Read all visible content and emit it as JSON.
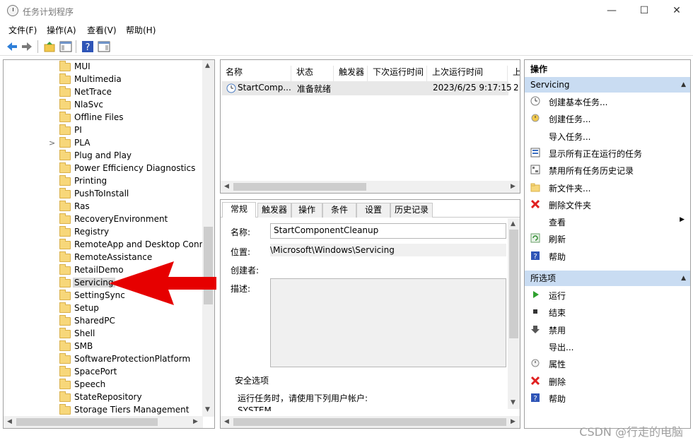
{
  "window": {
    "title": "任务计划程序",
    "minimize": "—",
    "maximize": "☐",
    "close": "✕"
  },
  "menu": [
    "文件(F)",
    "操作(A)",
    "查看(V)",
    "帮助(H)"
  ],
  "tree": {
    "items": [
      {
        "label": "MUI",
        "expander": ""
      },
      {
        "label": "Multimedia",
        "expander": ""
      },
      {
        "label": "NetTrace",
        "expander": ""
      },
      {
        "label": "NlaSvc",
        "expander": ""
      },
      {
        "label": "Offline Files",
        "expander": ""
      },
      {
        "label": "PI",
        "expander": ""
      },
      {
        "label": "PLA",
        "expander": ">"
      },
      {
        "label": "Plug and Play",
        "expander": ""
      },
      {
        "label": "Power Efficiency Diagnostics",
        "expander": ""
      },
      {
        "label": "Printing",
        "expander": ""
      },
      {
        "label": "PushToInstall",
        "expander": ""
      },
      {
        "label": "Ras",
        "expander": ""
      },
      {
        "label": "RecoveryEnvironment",
        "expander": ""
      },
      {
        "label": "Registry",
        "expander": ""
      },
      {
        "label": "RemoteApp and Desktop Conn",
        "expander": ""
      },
      {
        "label": "RemoteAssistance",
        "expander": ""
      },
      {
        "label": "RetailDemo",
        "expander": ""
      },
      {
        "label": "Servicing",
        "expander": "",
        "selected": true
      },
      {
        "label": "SettingSync",
        "expander": ""
      },
      {
        "label": "Setup",
        "expander": ""
      },
      {
        "label": "SharedPC",
        "expander": ""
      },
      {
        "label": "Shell",
        "expander": ""
      },
      {
        "label": "SMB",
        "expander": ""
      },
      {
        "label": "SoftwareProtectionPlatform",
        "expander": ""
      },
      {
        "label": "SpacePort",
        "expander": ""
      },
      {
        "label": "Speech",
        "expander": ""
      },
      {
        "label": "StateRepository",
        "expander": ""
      },
      {
        "label": "Storage Tiers Management",
        "expander": ""
      }
    ]
  },
  "tasks": {
    "columns": [
      "名称",
      "状态",
      "触发器",
      "下次运行时间",
      "上次运行时间",
      "上"
    ],
    "rows": [
      {
        "name": "StartComp...",
        "status": "准备就绪",
        "trigger": "",
        "next": "",
        "last": "2023/6/25 9:17:15",
        "extra": "2"
      }
    ]
  },
  "details": {
    "tabs": [
      "常规",
      "触发器",
      "操作",
      "条件",
      "设置",
      "历史记录"
    ],
    "name_label": "名称:",
    "name_value": "StartComponentCleanup",
    "location_label": "位置:",
    "location_value": "\\Microsoft\\Windows\\Servicing",
    "author_label": "创建者:",
    "description_label": "描述:",
    "security_title": "安全选项",
    "security_text": "运行任务时，请使用下列用户帐户:",
    "security_account": "SYSTEM"
  },
  "actions": {
    "header": "操作",
    "section1": {
      "title": "Servicing",
      "items": [
        {
          "label": "创建基本任务...",
          "icon": "clock-icon"
        },
        {
          "label": "创建任务...",
          "icon": "task-icon"
        },
        {
          "label": "导入任务...",
          "icon": ""
        },
        {
          "label": "显示所有正在运行的任务",
          "icon": "list-icon"
        },
        {
          "label": "禁用所有任务历史记录",
          "icon": "history-icon"
        },
        {
          "label": "新文件夹...",
          "icon": "folder-icon"
        },
        {
          "label": "删除文件夹",
          "icon": "delete-icon"
        },
        {
          "label": "查看",
          "icon": "",
          "submenu": "▶"
        },
        {
          "label": "刷新",
          "icon": "refresh-icon"
        },
        {
          "label": "帮助",
          "icon": "help-icon"
        }
      ]
    },
    "section2": {
      "title": "所选项",
      "items": [
        {
          "label": "运行",
          "icon": "run-icon"
        },
        {
          "label": "结束",
          "icon": "stop-icon"
        },
        {
          "label": "禁用",
          "icon": "disable-icon"
        },
        {
          "label": "导出...",
          "icon": ""
        },
        {
          "label": "属性",
          "icon": "properties-icon"
        },
        {
          "label": "删除",
          "icon": "delete-icon"
        },
        {
          "label": "帮助",
          "icon": "help-icon"
        }
      ]
    }
  },
  "watermark": "CSDN @行走的电脑",
  "colors": {
    "section_header": "#c9dcf2",
    "arrow": "#e60000",
    "selected": "#d9d9d9"
  }
}
